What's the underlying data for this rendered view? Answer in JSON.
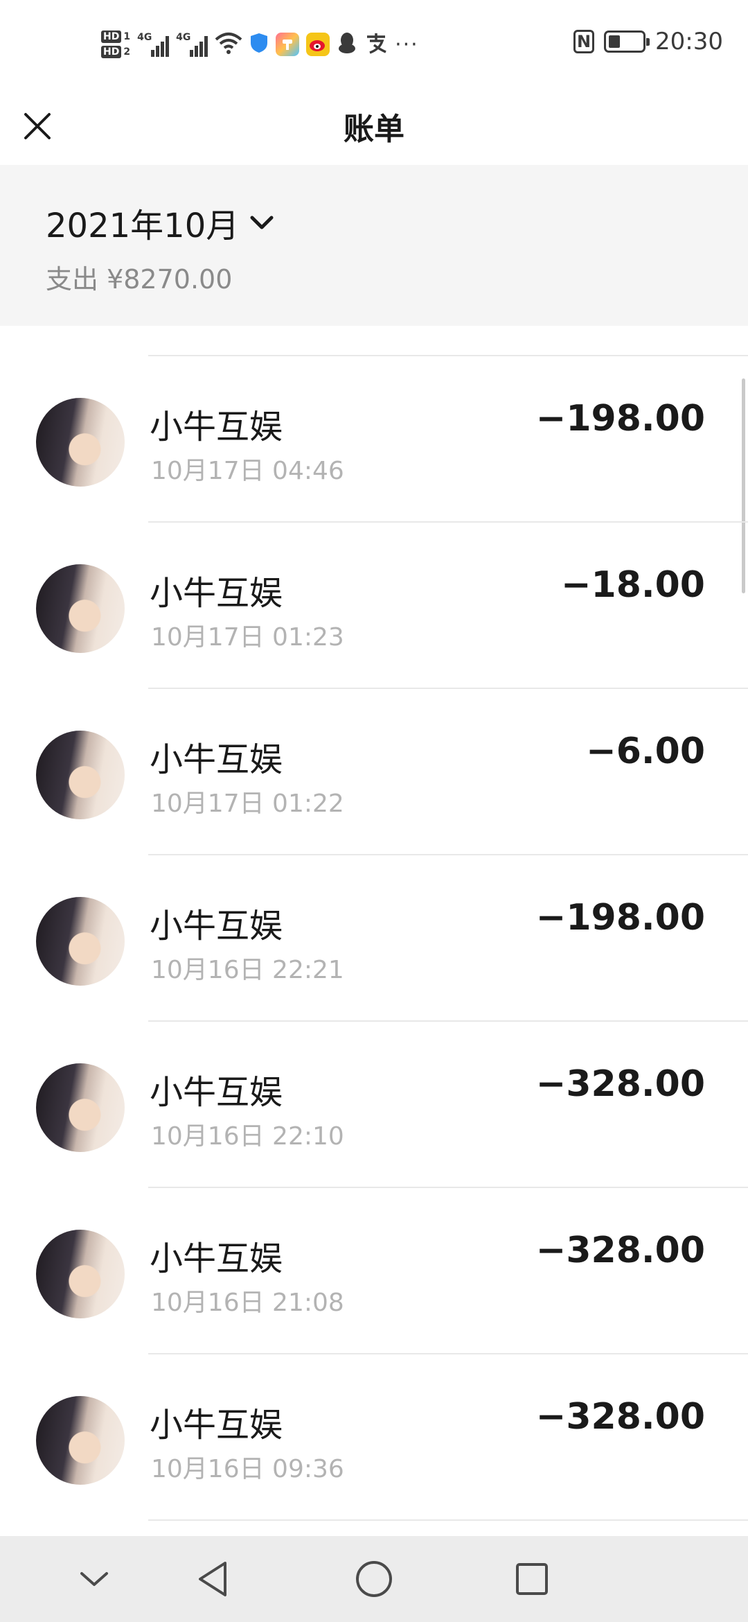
{
  "status_bar": {
    "hd1_label": "HD",
    "hd1_sim": "1",
    "hd2_label": "HD",
    "hd2_sim": "2",
    "network1": "4G",
    "network2": "4G",
    "more": "···",
    "nfc_label": "N",
    "battery_level": 0.35,
    "time": "20:30"
  },
  "header": {
    "title": "账单"
  },
  "summary": {
    "month": "2021年10月",
    "expense": "支出 ¥8270.00"
  },
  "transactions": [
    {
      "merchant": "小牛互娱",
      "time": "10月17日 04:46",
      "amount": "−198.00"
    },
    {
      "merchant": "小牛互娱",
      "time": "10月17日 01:23",
      "amount": "−18.00"
    },
    {
      "merchant": "小牛互娱",
      "time": "10月17日 01:22",
      "amount": "−6.00"
    },
    {
      "merchant": "小牛互娱",
      "time": "10月16日 22:21",
      "amount": "−198.00"
    },
    {
      "merchant": "小牛互娱",
      "time": "10月16日 22:10",
      "amount": "−328.00"
    },
    {
      "merchant": "小牛互娱",
      "time": "10月16日 21:08",
      "amount": "−328.00"
    },
    {
      "merchant": "小牛互娱",
      "time": "10月16日 09:36",
      "amount": "−328.00"
    }
  ],
  "colors": {
    "accent_blue": "#2d8cf0",
    "weibo_red": "#e6162d",
    "divider": "#e8e8e8",
    "muted_text": "#b3b3b3"
  },
  "icons": {
    "close": "close-icon",
    "month_dropdown": "chevron-down-icon",
    "nav_hide": "chevron-down-icon",
    "nav_back": "back-triangle-icon",
    "nav_home": "home-circle-icon",
    "nav_recents": "recents-square-icon"
  }
}
